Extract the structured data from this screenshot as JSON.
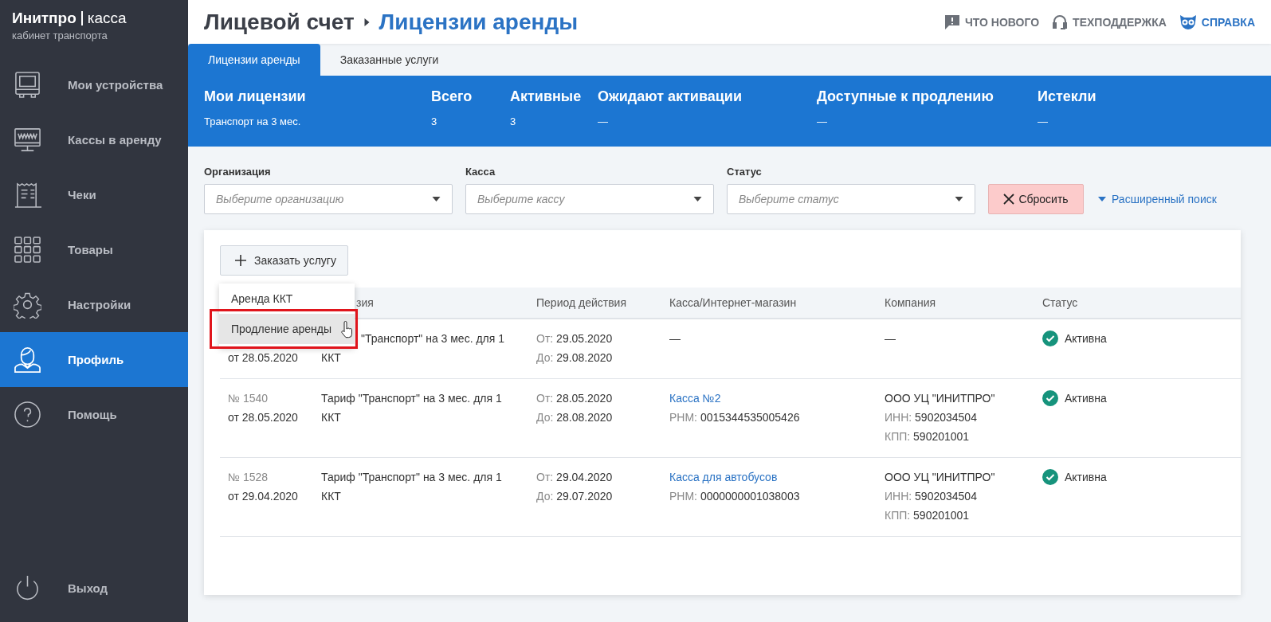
{
  "brand": {
    "name": "Инитпро",
    "product": "касса",
    "subtitle": "кабинет транспорта"
  },
  "sidebar": {
    "items": [
      {
        "label": "Мои устройства",
        "kind": "device",
        "selected": false
      },
      {
        "label": "Кассы в аренду",
        "kind": "www",
        "selected": false
      },
      {
        "label": "Чеки",
        "kind": "receipt",
        "selected": false
      },
      {
        "label": "Товары",
        "kind": "grid",
        "selected": false
      },
      {
        "label": "Настройки",
        "kind": "gear",
        "selected": false
      },
      {
        "label": "Профиль",
        "kind": "person",
        "selected": true
      },
      {
        "label": "Помощь",
        "kind": "question",
        "selected": false
      }
    ],
    "logout": "Выход"
  },
  "breadcrumb": {
    "parent": "Лицевой счет",
    "current": "Лицензии аренды"
  },
  "top_links": [
    {
      "label": "ЧТО НОВОГО",
      "kind": "news"
    },
    {
      "label": "ТЕХПОДДЕРЖКА",
      "kind": "support"
    },
    {
      "label": "СПРАВКА",
      "kind": "help"
    }
  ],
  "tabs": [
    {
      "label": "Лицензии аренды",
      "selected": true
    },
    {
      "label": "Заказанные услуги",
      "selected": false
    }
  ],
  "summary": {
    "title": "Мои лицензии",
    "value": "Транспорт на 3 мес.",
    "columns": [
      {
        "label": "Всего",
        "value": "3"
      },
      {
        "label": "Активные",
        "value": "3"
      },
      {
        "label": "Ожидают активации",
        "value": "—"
      },
      {
        "label": "Доступные к продлению",
        "value": "—"
      },
      {
        "label": "Истекли",
        "value": "—"
      }
    ]
  },
  "filters": [
    {
      "label": "Организация",
      "placeholder": "Выберите организацию"
    },
    {
      "label": "Касса",
      "placeholder": "Выберите кассу"
    },
    {
      "label": "Статус",
      "placeholder": "Выберите статус"
    }
  ],
  "reset_button": "Сбросить",
  "advanced_search": "Расширенный поиск",
  "order_button": "Заказать услугу",
  "order_menu": [
    {
      "label": "Аренда ККТ",
      "selected": false
    },
    {
      "label": "Продление аренды",
      "selected": true
    }
  ],
  "table": {
    "columns": [
      "зия",
      "Период действия",
      "Касса/Интернет-магазин",
      "Компания",
      "Статус"
    ],
    "rows": [
      {
        "date": "от 28.05.2020",
        "license": [
          "\"Транспорт\" на 3 мес. для 1",
          "ККТ"
        ],
        "from_label": "От:",
        "from": "29.05.2020",
        "to_label": "До:",
        "to": "29.08.2020",
        "kassa": "—",
        "company": "—",
        "status": "Активна",
        "kind": "active"
      },
      {
        "number": "№ 1540",
        "date": "от 28.05.2020",
        "license": [
          "Тариф \"Транспорт\" на 3 мес. для 1",
          "ККТ"
        ],
        "from_label": "От:",
        "from": "28.05.2020",
        "to_label": "До:",
        "to": "28.08.2020",
        "kassa_link": "Касса №2",
        "rnm_label": "РНМ:",
        "rnm": "0015344535005426",
        "company_name": "ООО УЦ \"ИНИТПРО\"",
        "inn_label": "ИНН:",
        "inn": "5902034504",
        "kpp_label": "КПП:",
        "kpp": "590201001",
        "status": "Активна",
        "kind": "active"
      },
      {
        "number": "№ 1528",
        "date": "от 29.04.2020",
        "license": [
          "Тариф \"Транспорт\" на 3 мес. для 1",
          "ККТ"
        ],
        "from_label": "От:",
        "from": "29.04.2020",
        "to_label": "До:",
        "to": "29.07.2020",
        "kassa_link": "Касса для автобусов",
        "rnm_label": "РНМ:",
        "rnm": "0000000001038003",
        "company_name": "ООО УЦ \"ИНИТПРО\"",
        "inn_label": "ИНН:",
        "inn": "5902034504",
        "kpp_label": "КПП:",
        "kpp": "590201001",
        "status": "Активна",
        "kind": "active"
      }
    ]
  }
}
